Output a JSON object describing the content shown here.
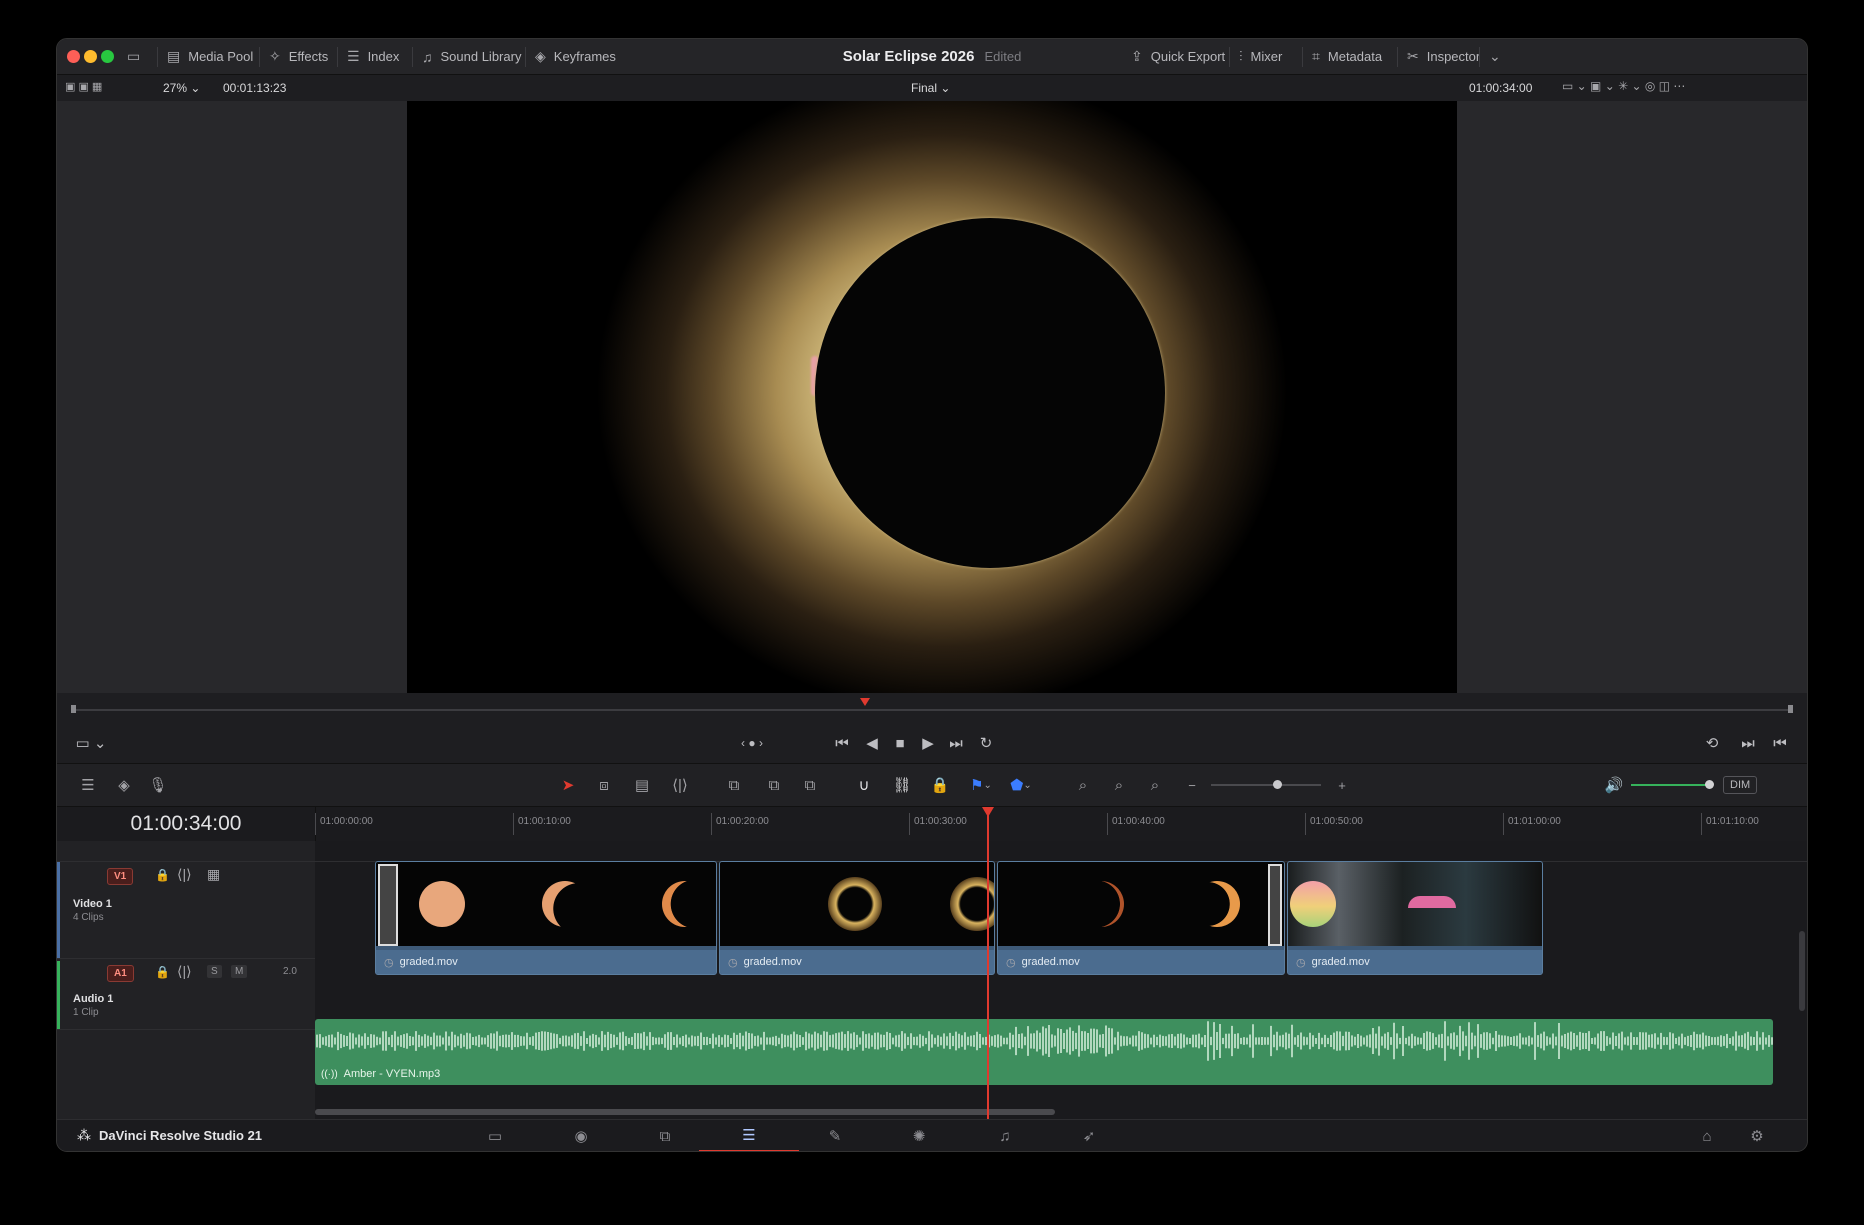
{
  "toolbar": {
    "items": [
      {
        "label": "Media Pool"
      },
      {
        "label": "Effects"
      },
      {
        "label": "Index"
      },
      {
        "label": "Sound Library"
      },
      {
        "label": "Keyframes"
      }
    ],
    "right_items": [
      {
        "label": "Quick Export"
      },
      {
        "label": "Mixer"
      },
      {
        "label": "Metadata"
      },
      {
        "label": "Inspector"
      }
    ],
    "project_title": "Solar Eclipse 2026",
    "project_status": "Edited"
  },
  "viewer": {
    "zoom": "27%",
    "source_timecode": "00:01:13:23",
    "mode": "Final",
    "timecode": "01:00:34:00"
  },
  "timeline": {
    "current_timecode": "01:00:34:00",
    "ruler": [
      "01:00:00:00",
      "01:00:10:00",
      "01:00:20:00",
      "01:00:30:00",
      "01:00:40:00",
      "01:00:50:00",
      "01:01:00:00",
      "01:01:10:00"
    ],
    "video_track": {
      "id": "V1",
      "name": "Video 1",
      "clips_count": "4 Clips"
    },
    "audio_track": {
      "id": "A1",
      "name": "Audio 1",
      "clips_count": "1 Clip",
      "solo": "S",
      "mute": "M",
      "channels": "2.0"
    },
    "video_clips": [
      {
        "name": "graded.mov"
      },
      {
        "name": "graded.mov"
      },
      {
        "name": "graded.mov"
      },
      {
        "name": "graded.mov"
      }
    ],
    "audio_clip": {
      "name": "Amber - VYEN.mp3"
    },
    "playhead_fraction": 0.31
  },
  "audio_monitor": {
    "dim_label": "DIM"
  },
  "app": {
    "name": "DaVinci Resolve Studio 21",
    "active_page": "edit"
  },
  "colors": {
    "accent": "#e03a2f",
    "video_clip": "#4b6c8f",
    "audio_clip": "#3e8f5e"
  }
}
